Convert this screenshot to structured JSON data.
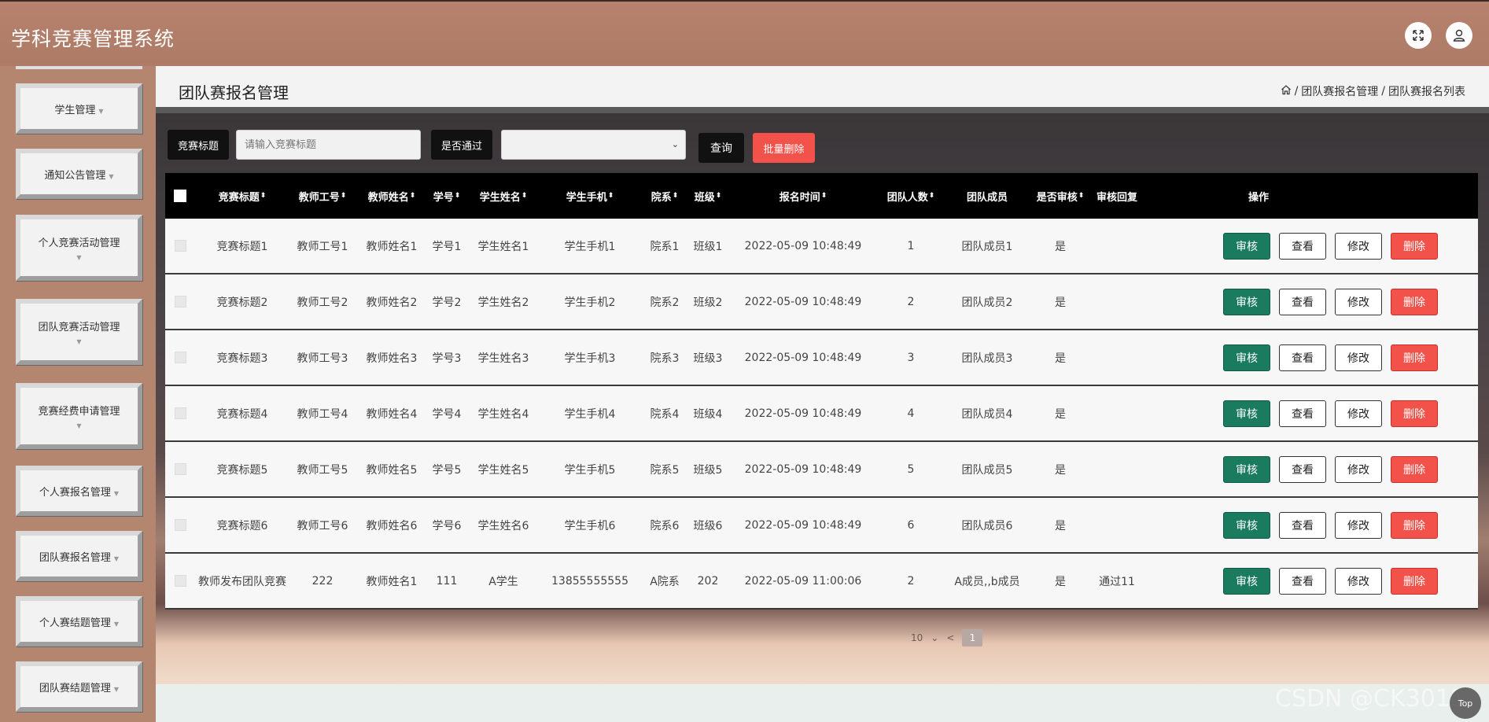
{
  "app": {
    "title": "学科竞赛管理系统"
  },
  "header": {
    "fullscreen_icon": "fullscreen-icon",
    "user_icon": "user-icon"
  },
  "sidebar": {
    "items": [
      {
        "label": "学生管理"
      },
      {
        "label": "通知公告管理"
      },
      {
        "label": "个人竞赛活动管理"
      },
      {
        "label": "团队竞赛活动管理"
      },
      {
        "label": "竞赛经费申请管理"
      },
      {
        "label": "个人赛报名管理"
      },
      {
        "label": "团队赛报名管理"
      },
      {
        "label": "个人赛结题管理"
      },
      {
        "label": "团队赛结题管理"
      }
    ]
  },
  "page": {
    "title": "团队赛报名管理",
    "breadcrumb": {
      "home_icon": "home-icon",
      "level1": "团队赛报名管理",
      "level2": "团队赛报名列表",
      "sep": "/"
    }
  },
  "search": {
    "title_label": "竞赛标题",
    "title_placeholder": "请输入竞赛标题",
    "pass_label": "是否通过",
    "pass_value": "",
    "query_label": "查询",
    "batch_delete_label": "批量删除"
  },
  "table": {
    "headers": [
      "竞赛标题",
      "教师工号",
      "教师姓名",
      "学号",
      "学生姓名",
      "学生手机",
      "院系",
      "班级",
      "报名时间",
      "团队人数",
      "团队成员",
      "是否审核",
      "审核回复",
      "操作"
    ],
    "sort_glyph": "⬍",
    "rows": [
      [
        "竞赛标题1",
        "教师工号1",
        "教师姓名1",
        "学号1",
        "学生姓名1",
        "学生手机1",
        "院系1",
        "班级1",
        "2022-05-09 10:48:49",
        "1",
        "团队成员1",
        "是",
        ""
      ],
      [
        "竞赛标题2",
        "教师工号2",
        "教师姓名2",
        "学号2",
        "学生姓名2",
        "学生手机2",
        "院系2",
        "班级2",
        "2022-05-09 10:48:49",
        "2",
        "团队成员2",
        "是",
        ""
      ],
      [
        "竞赛标题3",
        "教师工号3",
        "教师姓名3",
        "学号3",
        "学生姓名3",
        "学生手机3",
        "院系3",
        "班级3",
        "2022-05-09 10:48:49",
        "3",
        "团队成员3",
        "是",
        ""
      ],
      [
        "竞赛标题4",
        "教师工号4",
        "教师姓名4",
        "学号4",
        "学生姓名4",
        "学生手机4",
        "院系4",
        "班级4",
        "2022-05-09 10:48:49",
        "4",
        "团队成员4",
        "是",
        ""
      ],
      [
        "竞赛标题5",
        "教师工号5",
        "教师姓名5",
        "学号5",
        "学生姓名5",
        "学生手机5",
        "院系5",
        "班级5",
        "2022-05-09 10:48:49",
        "5",
        "团队成员5",
        "是",
        ""
      ],
      [
        "竞赛标题6",
        "教师工号6",
        "教师姓名6",
        "学号6",
        "学生姓名6",
        "学生手机6",
        "院系6",
        "班级6",
        "2022-05-09 10:48:49",
        "6",
        "团队成员6",
        "是",
        ""
      ],
      [
        "教师发布团队竞赛",
        "222",
        "教师姓名1",
        "111",
        "A学生",
        "13855555555",
        "A院系",
        "202",
        "2022-05-09 11:00:06",
        "2",
        "A成员,,b成员",
        "是",
        "通过11"
      ]
    ],
    "actions": {
      "audit": "审核",
      "view": "查看",
      "edit": "修改",
      "delete": "删除"
    }
  },
  "pagination": {
    "page_size": "10",
    "current": "1"
  },
  "watermark": "CSDN @CK3011",
  "top_button": "Top"
}
